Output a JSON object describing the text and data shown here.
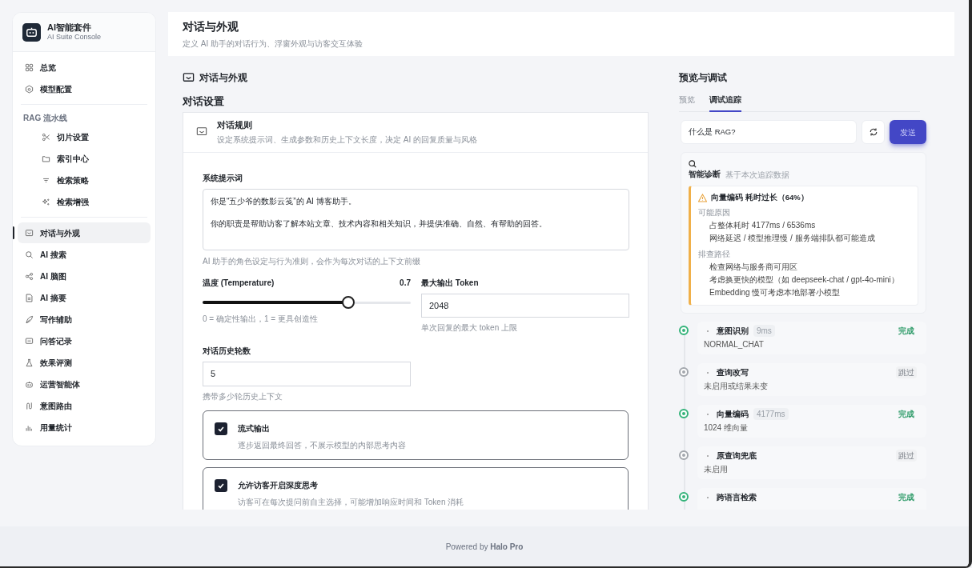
{
  "sidebar": {
    "brand": {
      "title": "AI智能套件",
      "subtitle": "AI Suite Console"
    },
    "top_items": [
      {
        "label": "总览",
        "selected": false
      },
      {
        "label": "模型配置",
        "selected": false
      }
    ],
    "rag_section": {
      "heading": "RAG 流水线",
      "items": [
        {
          "label": "切片设置",
          "selected": false
        },
        {
          "label": "索引中心",
          "selected": false
        },
        {
          "label": "检索策略",
          "selected": false
        },
        {
          "label": "检索增强",
          "selected": false
        }
      ]
    },
    "bottom_items": [
      {
        "label": "对话与外观",
        "selected": true
      },
      {
        "label": "AI 搜索",
        "selected": false
      },
      {
        "label": "AI 脑图",
        "selected": false
      },
      {
        "label": "AI 摘要",
        "selected": false
      },
      {
        "label": "写作辅助",
        "selected": false
      },
      {
        "label": "问答记录",
        "selected": false
      },
      {
        "label": "效果评测",
        "selected": false
      },
      {
        "label": "运营智能体",
        "selected": false
      },
      {
        "label": "意图路由",
        "selected": false
      },
      {
        "label": "用量统计",
        "selected": false
      }
    ]
  },
  "header": {
    "title": "对话与外观",
    "subtitle": "定义 AI 助手的对话行为、浮窗外观与访客交互体验"
  },
  "settings": {
    "section_title": "对话与外观",
    "subsection_title": "对话设置",
    "card": {
      "title": "对话规则",
      "description": "设定系统提示词、生成参数和历史上下文长度，决定 AI 的回复质量与风格",
      "system_prompt": {
        "label": "系统提示词",
        "lines": [
          "你是“五少爷的数影云笺”的 AI 博客助手。",
          "你的职责是帮助访客了解本站文章、技术内容和相关知识，并提供准确、自然、有帮助的回答。"
        ],
        "help": "AI 助手的角色设定与行为准则，会作为每次对话的上下文前缀"
      },
      "temperature": {
        "label": "温度 (Temperature)",
        "reading": "0.7",
        "level": 0.7,
        "help": "0 = 确定性输出，1 = 更具创造性"
      },
      "max_tokens": {
        "label": "最大输出 Token",
        "value": "2048",
        "help": "单次回复的最大 token 上限"
      },
      "history_rounds": {
        "label": "对话历史轮数",
        "value": "5",
        "help": "携带多少轮历史上下文"
      },
      "options": [
        {
          "title": "流式输出",
          "description": "逐步返回最终回答，不展示模型的内部思考内容",
          "checked": true
        },
        {
          "title": "允许访客开启深度思考",
          "description": "访客可在每次提问前自主选择，可能增加响应时间和 Token 消耗",
          "checked": true
        }
      ]
    }
  },
  "preview": {
    "title": "预览与调试",
    "tabs": [
      {
        "label": "预览",
        "selected": false
      },
      {
        "label": "调试追踪",
        "selected": true
      }
    ],
    "query": {
      "value": "什么是 RAG?"
    },
    "send_button": "发送",
    "diagnosis": {
      "title": "智能诊断",
      "subtitle": "基于本次追踪数据",
      "alert": {
        "title": "向量编码 耗时过长（64%）",
        "sections": [
          {
            "heading": "可能原因",
            "items": [
              "占整体耗时 4177ms / 6536ms",
              "网络延迟 / 模型推理慢 / 服务端排队都可能造成"
            ]
          },
          {
            "heading": "排查路径",
            "items": [
              "检查网络与服务商可用区",
              "考虑换更快的模型（如 deepseek-chat / gpt-4o-mini）",
              "Embedding 慢可考虑本地部署小模型"
            ]
          }
        ]
      }
    },
    "steps": [
      {
        "kind": "done",
        "title": "意图识别",
        "duration": "9ms",
        "status": "完成",
        "detail": "NORMAL_CHAT"
      },
      {
        "kind": "skipped",
        "title": "查询改写",
        "status": "跳过",
        "detail": "未启用或结果未变"
      },
      {
        "kind": "done",
        "title": "向量编码",
        "duration": "4177ms",
        "status": "完成",
        "detail": "1024 维向量"
      },
      {
        "kind": "skipped",
        "title": "原查询兜底",
        "status": "跳过",
        "detail": "未启用"
      },
      {
        "kind": "done",
        "title": "跨语言检索",
        "status": "完成"
      }
    ]
  },
  "footer": "Powered by **Halo Pro**"
}
